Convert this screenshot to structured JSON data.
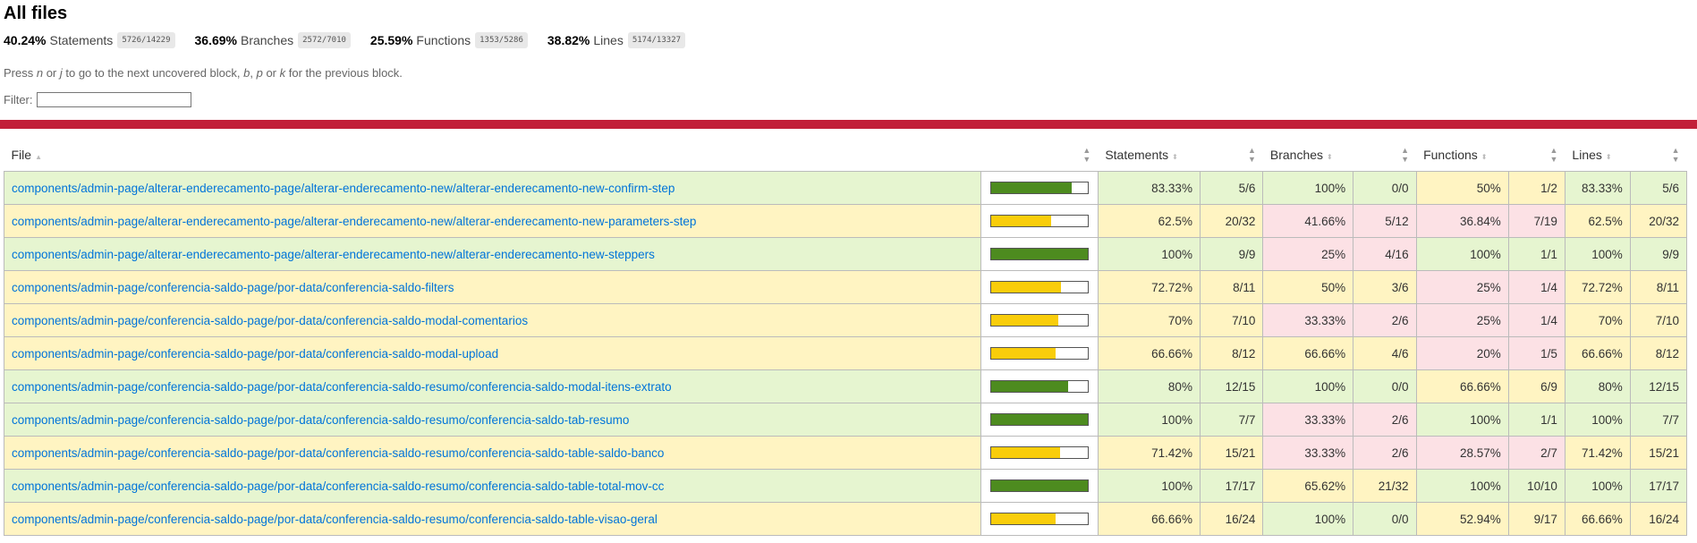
{
  "title": "All files",
  "summary": [
    {
      "pct": "40.24%",
      "label": "Statements",
      "fraction": "5726/14229"
    },
    {
      "pct": "36.69%",
      "label": "Branches",
      "fraction": "2572/7010"
    },
    {
      "pct": "25.59%",
      "label": "Functions",
      "fraction": "1353/5286"
    },
    {
      "pct": "38.82%",
      "label": "Lines",
      "fraction": "5174/13327"
    }
  ],
  "hint": {
    "t1": "Press ",
    "k1": "n",
    "t2": " or ",
    "k2": "j",
    "t3": " to go to the next uncovered block, ",
    "k3": "b",
    "t4": ", ",
    "k4": "p",
    "t5": " or ",
    "k5": "k",
    "t6": " for the previous block."
  },
  "filter_label": "Filter:",
  "columns": {
    "file": "File",
    "statements": "Statements",
    "branches": "Branches",
    "functions": "Functions",
    "lines": "Lines"
  },
  "colors": {
    "high": "#e6f5d0",
    "medium": "#fff4c2",
    "low": "#fce1e5",
    "accent": "#c21f39",
    "link": "#0074d9"
  },
  "rows": [
    {
      "file": "components/admin-page/alterar-enderecamento-page/alterar-enderecamento-new/alterar-enderecamento-new-confirm-step",
      "level": "high",
      "bar": 0.8333,
      "s": "83.33%",
      "sf": "5/6",
      "sl": "high",
      "b": "100%",
      "bf": "0/0",
      "bl": "high",
      "f": "50%",
      "ff": "1/2",
      "fl": "medium",
      "l": "83.33%",
      "lf": "5/6",
      "ll": "high"
    },
    {
      "file": "components/admin-page/alterar-enderecamento-page/alterar-enderecamento-new/alterar-enderecamento-new-parameters-step",
      "level": "medium",
      "bar": 0.625,
      "s": "62.5%",
      "sf": "20/32",
      "sl": "medium",
      "b": "41.66%",
      "bf": "5/12",
      "bl": "low",
      "f": "36.84%",
      "ff": "7/19",
      "fl": "low",
      "l": "62.5%",
      "lf": "20/32",
      "ll": "medium"
    },
    {
      "file": "components/admin-page/alterar-enderecamento-page/alterar-enderecamento-new/alterar-enderecamento-new-steppers",
      "level": "high",
      "bar": 1,
      "s": "100%",
      "sf": "9/9",
      "sl": "high",
      "b": "25%",
      "bf": "4/16",
      "bl": "low",
      "f": "100%",
      "ff": "1/1",
      "fl": "high",
      "l": "100%",
      "lf": "9/9",
      "ll": "high"
    },
    {
      "file": "components/admin-page/conferencia-saldo-page/por-data/conferencia-saldo-filters",
      "level": "medium",
      "bar": 0.7272,
      "s": "72.72%",
      "sf": "8/11",
      "sl": "medium",
      "b": "50%",
      "bf": "3/6",
      "bl": "medium",
      "f": "25%",
      "ff": "1/4",
      "fl": "low",
      "l": "72.72%",
      "lf": "8/11",
      "ll": "medium"
    },
    {
      "file": "components/admin-page/conferencia-saldo-page/por-data/conferencia-saldo-modal-comentarios",
      "level": "medium",
      "bar": 0.7,
      "s": "70%",
      "sf": "7/10",
      "sl": "medium",
      "b": "33.33%",
      "bf": "2/6",
      "bl": "low",
      "f": "25%",
      "ff": "1/4",
      "fl": "low",
      "l": "70%",
      "lf": "7/10",
      "ll": "medium"
    },
    {
      "file": "components/admin-page/conferencia-saldo-page/por-data/conferencia-saldo-modal-upload",
      "level": "medium",
      "bar": 0.6666,
      "s": "66.66%",
      "sf": "8/12",
      "sl": "medium",
      "b": "66.66%",
      "bf": "4/6",
      "bl": "medium",
      "f": "20%",
      "ff": "1/5",
      "fl": "low",
      "l": "66.66%",
      "lf": "8/12",
      "ll": "medium"
    },
    {
      "file": "components/admin-page/conferencia-saldo-page/por-data/conferencia-saldo-resumo/conferencia-saldo-modal-itens-extrato",
      "level": "high",
      "bar": 0.8,
      "s": "80%",
      "sf": "12/15",
      "sl": "high",
      "b": "100%",
      "bf": "0/0",
      "bl": "high",
      "f": "66.66%",
      "ff": "6/9",
      "fl": "medium",
      "l": "80%",
      "lf": "12/15",
      "ll": "high"
    },
    {
      "file": "components/admin-page/conferencia-saldo-page/por-data/conferencia-saldo-resumo/conferencia-saldo-tab-resumo",
      "level": "high",
      "bar": 1,
      "s": "100%",
      "sf": "7/7",
      "sl": "high",
      "b": "33.33%",
      "bf": "2/6",
      "bl": "low",
      "f": "100%",
      "ff": "1/1",
      "fl": "high",
      "l": "100%",
      "lf": "7/7",
      "ll": "high"
    },
    {
      "file": "components/admin-page/conferencia-saldo-page/por-data/conferencia-saldo-resumo/conferencia-saldo-table-saldo-banco",
      "level": "medium",
      "bar": 0.7142,
      "s": "71.42%",
      "sf": "15/21",
      "sl": "medium",
      "b": "33.33%",
      "bf": "2/6",
      "bl": "low",
      "f": "28.57%",
      "ff": "2/7",
      "fl": "low",
      "l": "71.42%",
      "lf": "15/21",
      "ll": "medium"
    },
    {
      "file": "components/admin-page/conferencia-saldo-page/por-data/conferencia-saldo-resumo/conferencia-saldo-table-total-mov-cc",
      "level": "high",
      "bar": 1,
      "s": "100%",
      "sf": "17/17",
      "sl": "high",
      "b": "65.62%",
      "bf": "21/32",
      "bl": "medium",
      "f": "100%",
      "ff": "10/10",
      "fl": "high",
      "l": "100%",
      "lf": "17/17",
      "ll": "high"
    },
    {
      "file": "components/admin-page/conferencia-saldo-page/por-data/conferencia-saldo-resumo/conferencia-saldo-table-visao-geral",
      "level": "medium",
      "bar": 0.6666,
      "s": "66.66%",
      "sf": "16/24",
      "sl": "medium",
      "b": "100%",
      "bf": "0/0",
      "bl": "high",
      "f": "52.94%",
      "ff": "9/17",
      "fl": "medium",
      "l": "66.66%",
      "lf": "16/24",
      "ll": "medium"
    }
  ]
}
